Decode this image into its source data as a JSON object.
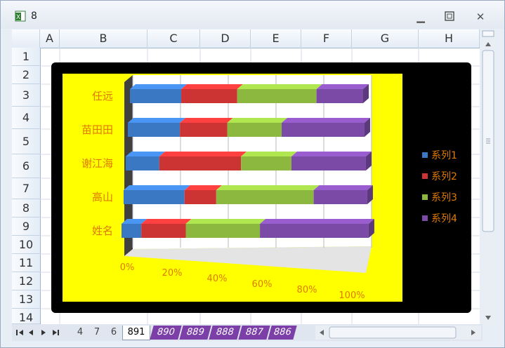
{
  "window": {
    "title": "8"
  },
  "columns": [
    "A",
    "B",
    "C",
    "D",
    "E",
    "F",
    "G",
    "H"
  ],
  "rows": [
    "1",
    "2",
    "3",
    "4",
    "5",
    "6",
    "7",
    "8",
    "9",
    "10",
    "11",
    "12",
    "13",
    "14"
  ],
  "sheet_tabs": {
    "left_tabs": [
      "4",
      "7",
      "6"
    ],
    "active_tab": "891",
    "right_tabs": [
      "890",
      "889",
      "888",
      "887",
      "886"
    ]
  },
  "chart_data": {
    "type": "bar",
    "stacked": "percent",
    "categories": [
      "任远",
      "苗田田",
      "谢江海",
      "高山",
      "姓名"
    ],
    "series": [
      {
        "name": "系列1",
        "values": [
          22,
          22,
          14,
          25,
          8
        ]
      },
      {
        "name": "系列2",
        "values": [
          24,
          20,
          34,
          13,
          18
        ]
      },
      {
        "name": "系列3",
        "values": [
          34,
          23,
          21,
          40,
          30
        ]
      },
      {
        "name": "系列4",
        "values": [
          20,
          35,
          31,
          22,
          44
        ]
      }
    ],
    "x_ticks": [
      "0%",
      "20%",
      "40%",
      "60%",
      "80%",
      "100%"
    ],
    "colors": {
      "系列1": "#3b78c4",
      "系列2": "#cc3333",
      "系列3": "#8db83f",
      "系列4": "#7a4aa6"
    },
    "plot_background": "#ffff00",
    "chart_background": "#000000",
    "legend": "right"
  }
}
